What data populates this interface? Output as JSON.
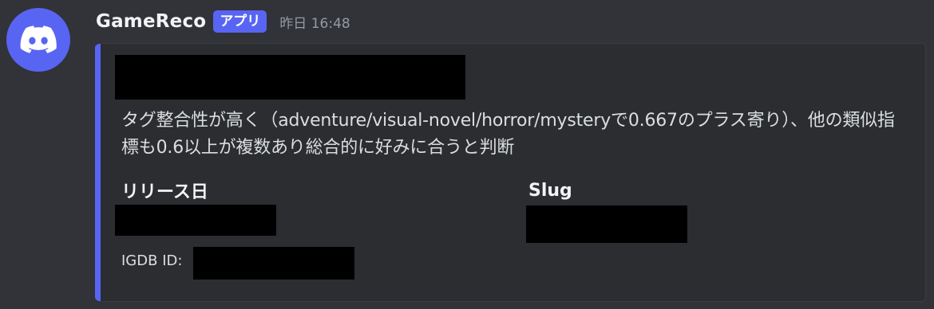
{
  "message": {
    "author": "GameReco",
    "badge": "アプリ",
    "timestamp": "昨日 16:48",
    "avatar_icon": "discord-logo-icon",
    "accent_color": "#5865f2"
  },
  "embed": {
    "description": "タグ整合性が高く（adventure/visual-novel/horror/mysteryで0.667のプラス寄り）、他の類似指標も0.6以上が複数あり総合的に好みに合うと判断",
    "fields": [
      {
        "name": "リリース日"
      },
      {
        "name": "Slug"
      }
    ],
    "footer_label": "IGDB ID:"
  }
}
